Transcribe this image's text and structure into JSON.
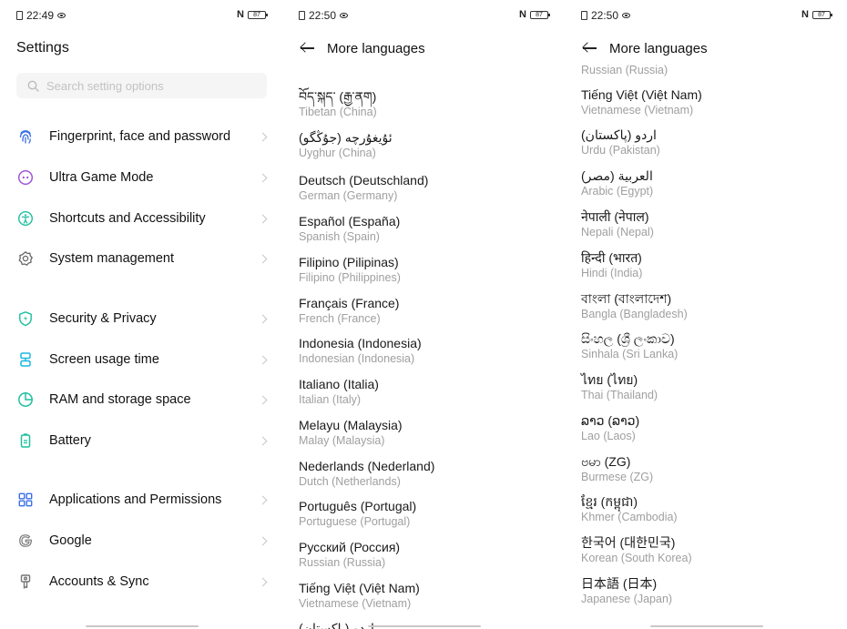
{
  "status_bars": [
    {
      "time": "22:49",
      "battery": "87"
    },
    {
      "time": "22:50",
      "battery": "87"
    },
    {
      "time": "22:50",
      "battery": "87"
    }
  ],
  "settings": {
    "title": "Settings",
    "search_placeholder": "Search setting options",
    "items": [
      {
        "label": "Fingerprint, face and password",
        "icon": "fingerprint-icon",
        "color": "#3a6ee8"
      },
      {
        "label": "Ultra Game Mode",
        "icon": "gamepad-icon",
        "color": "#9b4bd6"
      },
      {
        "label": "Shortcuts and Accessibility",
        "icon": "accessibility-icon",
        "color": "#1fbf9f"
      },
      {
        "label": "System management",
        "icon": "gear-icon",
        "color": "#666666"
      },
      {
        "label": "Security & Privacy",
        "icon": "shield-icon",
        "color": "#1fbf9f"
      },
      {
        "label": "Screen usage time",
        "icon": "hourglass-icon",
        "color": "#19b8e0"
      },
      {
        "label": "RAM and storage space",
        "icon": "pie-chart-icon",
        "color": "#1fbf9f"
      },
      {
        "label": "Battery",
        "icon": "battery-icon",
        "color": "#1fbf9f"
      },
      {
        "label": "Applications and Permissions",
        "icon": "grid-icon",
        "color": "#3a6ee8"
      },
      {
        "label": "Google",
        "icon": "google-icon",
        "color": "#777777"
      },
      {
        "label": "Accounts & Sync",
        "icon": "key-icon",
        "color": "#777777"
      }
    ]
  },
  "languages_panel_1": {
    "title": "More languages",
    "items": [
      {
        "native": "བོད་སྐད་ (རྒྱ་ནག)",
        "english": "Tibetan (China)"
      },
      {
        "native": "ئۇيغۇرچە (جۇڭگو)",
        "english": "Uyghur (China)"
      },
      {
        "native": "Deutsch (Deutschland)",
        "english": "German (Germany)"
      },
      {
        "native": "Español (España)",
        "english": "Spanish (Spain)"
      },
      {
        "native": "Filipino (Pilipinas)",
        "english": "Filipino (Philippines)"
      },
      {
        "native": "Français (France)",
        "english": "French (France)"
      },
      {
        "native": "Indonesia (Indonesia)",
        "english": "Indonesian (Indonesia)"
      },
      {
        "native": "Italiano (Italia)",
        "english": "Italian (Italy)"
      },
      {
        "native": "Melayu (Malaysia)",
        "english": "Malay (Malaysia)"
      },
      {
        "native": "Nederlands (Nederland)",
        "english": "Dutch (Netherlands)"
      },
      {
        "native": "Português (Portugal)",
        "english": "Portuguese (Portugal)"
      },
      {
        "native": "Русский (Россия)",
        "english": "Russian (Russia)"
      },
      {
        "native": "Tiếng Việt (Việt Nam)",
        "english": "Vietnamese (Vietnam)"
      },
      {
        "native": "اردو (پاکستان)",
        "english": ""
      }
    ]
  },
  "languages_panel_2": {
    "title": "More languages",
    "items": [
      {
        "native": "",
        "english": "Russian (Russia)"
      },
      {
        "native": "Tiếng Việt (Việt Nam)",
        "english": "Vietnamese (Vietnam)"
      },
      {
        "native": "اردو (پاکستان)",
        "english": "Urdu (Pakistan)"
      },
      {
        "native": "العربية (مصر)",
        "english": "Arabic (Egypt)"
      },
      {
        "native": "नेपाली (नेपाल)",
        "english": "Nepali (Nepal)"
      },
      {
        "native": "हिन्दी (भारत)",
        "english": "Hindi (India)"
      },
      {
        "native": "বাংলা (বাংলাদেশ)",
        "english": "Bangla (Bangladesh)"
      },
      {
        "native": "සිංහල (ශ්‍රී ලංකාව)",
        "english": "Sinhala (Sri Lanka)"
      },
      {
        "native": "ไทย (ไทย)",
        "english": "Thai (Thailand)"
      },
      {
        "native": "ລາວ (ລາວ)",
        "english": "Lao (Laos)"
      },
      {
        "native": "ဗမာ (ZG)",
        "english": "Burmese (ZG)"
      },
      {
        "native": "ខ្មែរ (កម្ពុជា)",
        "english": "Khmer (Cambodia)"
      },
      {
        "native": "한국어 (대한민국)",
        "english": "Korean (South Korea)"
      },
      {
        "native": "日本語 (日本)",
        "english": "Japanese (Japan)"
      }
    ]
  }
}
